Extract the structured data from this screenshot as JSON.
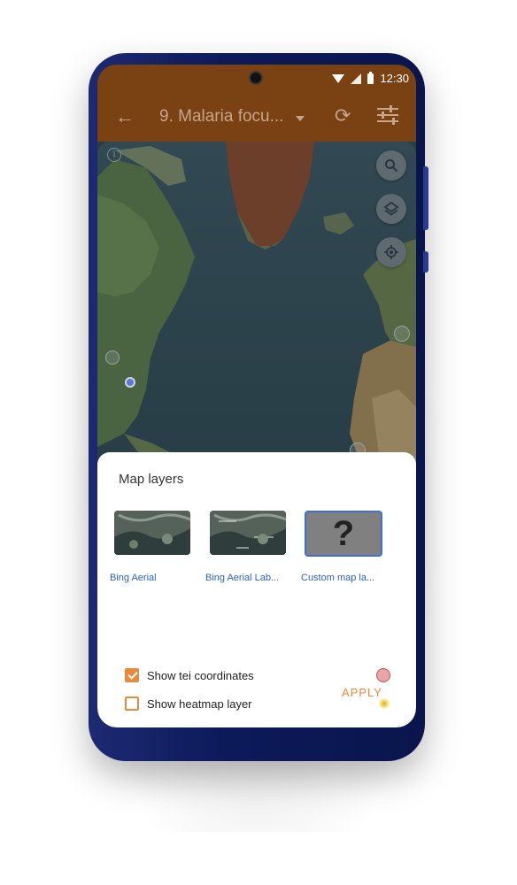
{
  "status_bar": {
    "time": "12:30",
    "icons": [
      "wifi-icon",
      "signal-icon",
      "battery-icon"
    ]
  },
  "toolbar": {
    "back_icon": "arrow-back-icon",
    "title": "9. Malaria focu...",
    "sync_icon": "sync-icon",
    "filter_icon": "filter-icon"
  },
  "map": {
    "buttons": [
      "search-icon",
      "layers-icon",
      "my-location-icon"
    ],
    "info_icon": "info-icon"
  },
  "sheet": {
    "title": "Map layers",
    "layers": [
      {
        "label": "Bing Aerial",
        "selected": false
      },
      {
        "label": "Bing Aerial Lab...",
        "selected": false
      },
      {
        "label": "Custom map la...",
        "selected": true,
        "placeholder": "?"
      }
    ],
    "options": [
      {
        "label": "Show tei coordinates",
        "checked": true
      },
      {
        "label": "Show heatmap layer",
        "checked": false
      }
    ],
    "apply_label": "APPLY"
  },
  "colors": {
    "appbar": "#7a4113",
    "accent": "#e8893c",
    "link": "#2b63c4",
    "phone_body": "#0c1a5a"
  }
}
